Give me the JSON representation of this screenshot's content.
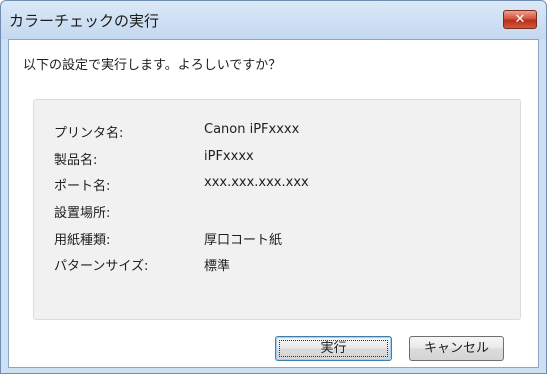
{
  "window": {
    "title": "カラーチェックの実行",
    "close_label": "✕"
  },
  "dialog": {
    "prompt": "以下の設定で実行します。よろしいですか？",
    "fields": [
      {
        "label": "プリンタ名:",
        "value": "Canon iPFxxxx"
      },
      {
        "label": "製品名:",
        "value": "iPFxxxx"
      },
      {
        "label": "ポート名:",
        "value": "xxx.xxx.xxx.xxx"
      },
      {
        "label": "設置場所:",
        "value": ""
      },
      {
        "label": "用紙種類:",
        "value": "厚口コート紙"
      },
      {
        "label": "パターンサイズ:",
        "value": "標準"
      }
    ]
  },
  "buttons": {
    "ok_label": "実行",
    "cancel_label": "キャンセル"
  }
}
